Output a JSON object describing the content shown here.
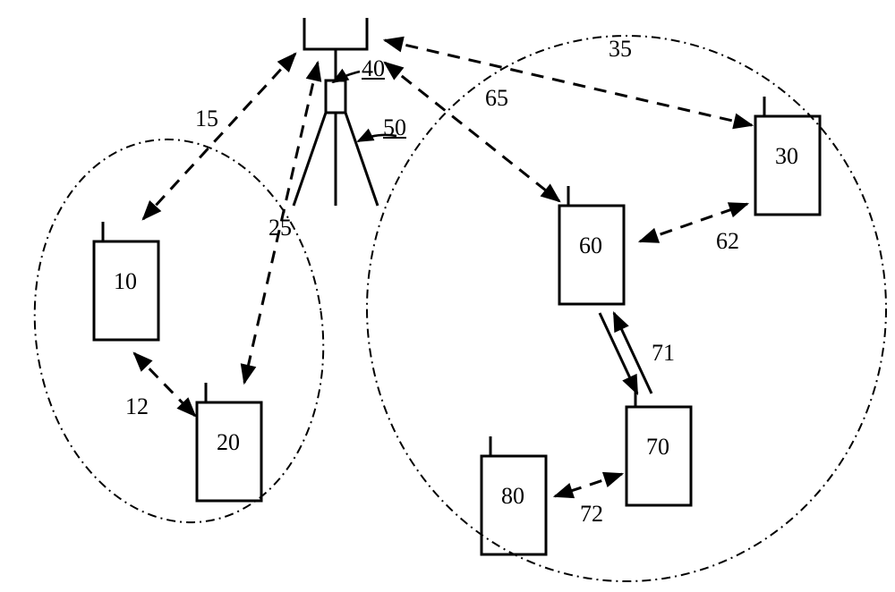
{
  "nodes": {
    "tower": {
      "id": "40",
      "mast": "50"
    },
    "ue10": "10",
    "ue20": "20",
    "ue30": "30",
    "ue60": "60",
    "ue70": "70",
    "ue80": "80"
  },
  "links": {
    "l15": "15",
    "l25": "25",
    "l35": "35",
    "l65": "65",
    "l12": "12",
    "l62": "62",
    "l71": "71",
    "l72": "72"
  }
}
